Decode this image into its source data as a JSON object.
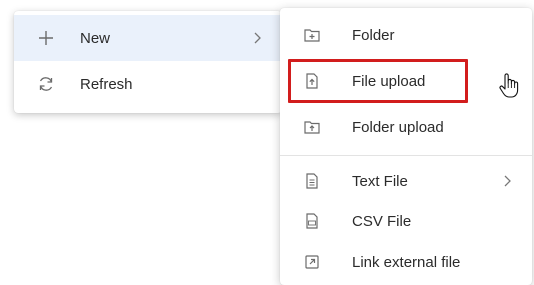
{
  "main_menu": {
    "items": [
      {
        "label": "New",
        "icon": "plus-icon",
        "has_submenu": true,
        "selected": true
      },
      {
        "label": "Refresh",
        "icon": "refresh-icon",
        "has_submenu": false
      }
    ]
  },
  "sub_menu": {
    "items": [
      {
        "label": "Folder",
        "icon": "folder-add-icon"
      },
      {
        "label": "File upload",
        "icon": "file-upload-icon",
        "highlighted": true
      },
      {
        "label": "Folder upload",
        "icon": "folder-upload-icon"
      },
      {
        "label": "Text File",
        "icon": "text-file-icon",
        "has_submenu": true
      },
      {
        "label": "CSV File",
        "icon": "csv-file-icon"
      },
      {
        "label": "Link external file",
        "icon": "external-link-icon"
      }
    ]
  },
  "colors": {
    "highlight_border": "#d21d1d",
    "selected_background": "#eaf1fb",
    "icon": "#6b6b6b"
  }
}
